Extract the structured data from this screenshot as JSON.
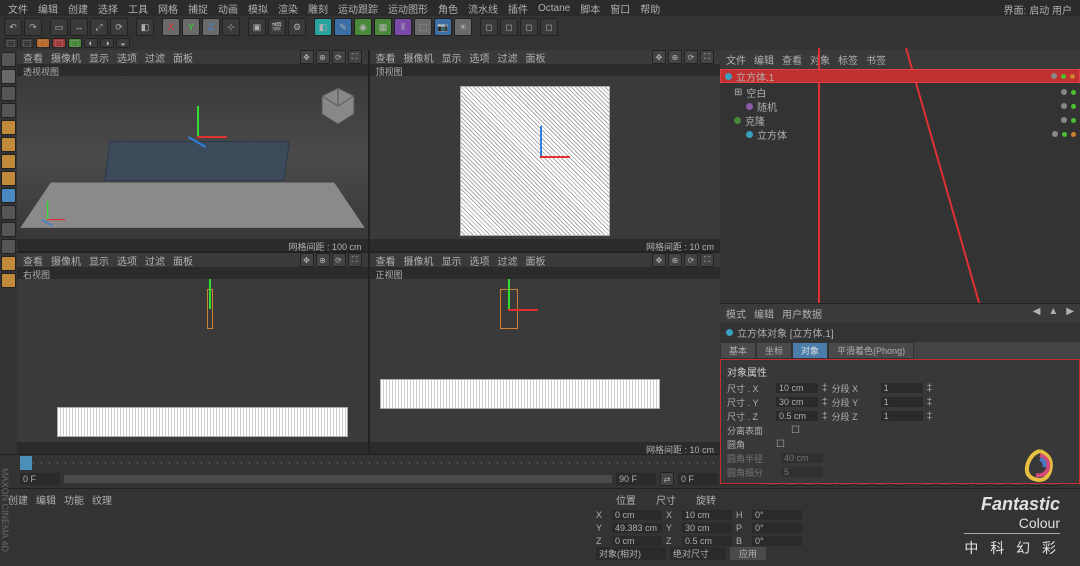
{
  "menu": {
    "items": [
      "文件",
      "编辑",
      "创建",
      "选择",
      "工具",
      "网格",
      "捕捉",
      "动画",
      "模拟",
      "渲染",
      "雕刻",
      "运动跟踪",
      "运动图形",
      "角色",
      "流水线",
      "插件",
      "Octane",
      "脚本",
      "窗口",
      "帮助"
    ]
  },
  "layout_label": "界面: 启动 用户",
  "viewport_menu": {
    "items": [
      "查看",
      "摄像机",
      "显示",
      "选项",
      "过滤",
      "面板"
    ]
  },
  "views": {
    "persp": {
      "name": "透视视图",
      "footer": "网格间距 : 100 cm"
    },
    "top": {
      "name": "顶视图",
      "footer": "网格间距 : 10 cm"
    },
    "right": {
      "name": "右视图",
      "footer": ""
    },
    "front": {
      "name": "正视图",
      "footer": "网格间距 : 10 cm"
    }
  },
  "obj_panel": {
    "tabs": [
      "文件",
      "编辑",
      "查看",
      "对象",
      "标签",
      "书签"
    ]
  },
  "objects": {
    "top": "立方体.1",
    "items": [
      {
        "indent": 0,
        "name": "空白",
        "icon": "grid"
      },
      {
        "indent": 1,
        "name": "随机",
        "icon": "dot"
      },
      {
        "indent": 0,
        "name": "克隆",
        "icon": "dot"
      },
      {
        "indent": 1,
        "name": "立方体",
        "icon": "cube"
      }
    ]
  },
  "attr_panel": {
    "tabs": [
      "模式",
      "编辑",
      "用户数据"
    ]
  },
  "attr_title": "立方体对象 [立方体.1]",
  "attr_tabs": {
    "basic": "基本",
    "coord": "坐标",
    "obj": "对象",
    "phong": "平滑着色(Phong)"
  },
  "attr_props": {
    "heading": "对象属性",
    "size_x_lbl": "尺寸 . X",
    "size_x": "10 cm",
    "seg_x_lbl": "分段 X",
    "seg_x": "1",
    "size_y_lbl": "尺寸 . Y",
    "size_y": "30 cm",
    "seg_y_lbl": "分段 Y",
    "seg_y": "1",
    "size_z_lbl": "尺寸 . Z",
    "size_z": "0.5 cm",
    "seg_z_lbl": "分段 Z",
    "seg_z": "1",
    "sep_surf": "分离表面",
    "fillet": "圆角",
    "fillet_rad_lbl": "圆角半径",
    "fillet_rad": "40 cm",
    "fillet_sub_lbl": "圆角细分",
    "fillet_sub": "5"
  },
  "timeline": {
    "start": "0 F",
    "end": "90 F",
    "cur": "0 F",
    "range_end": "90 F"
  },
  "material_tabs": [
    "创建",
    "编辑",
    "功能",
    "纹理"
  ],
  "coords": {
    "hdr_pos": "位置",
    "hdr_size": "尺寸",
    "hdr_rot": "旋转",
    "x": "0 cm",
    "sx": "10 cm",
    "h": "0°",
    "y": "49.383 cm",
    "sy": "30 cm",
    "p": "0°",
    "z": "0 cm",
    "sz": "0.5 cm",
    "b": "0°",
    "mode_lbl": "对象(相对)",
    "size_mode": "绝对尺寸",
    "apply": "应用"
  },
  "logo": {
    "fantastic": "Fantastic",
    "colour": "Colour",
    "cn": "中 科 幻 彩"
  },
  "sidetext": "MAXON CINEMA 4D"
}
